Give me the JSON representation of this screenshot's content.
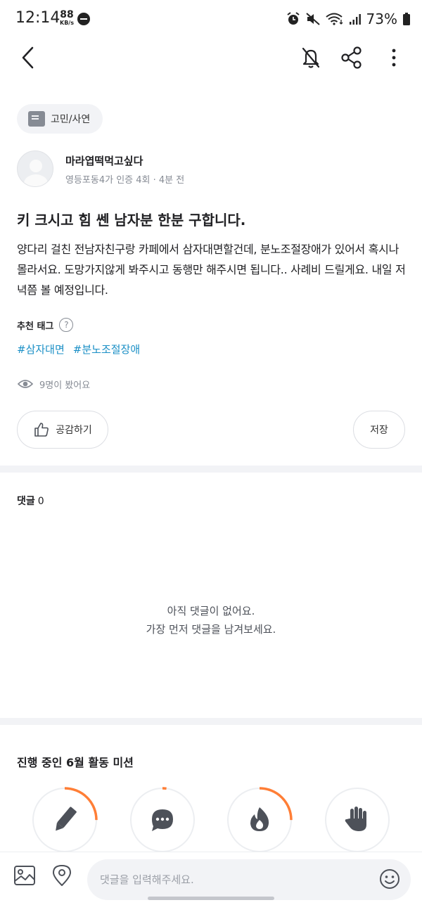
{
  "status_bar": {
    "time": "12:14",
    "net_speed_value": "88",
    "net_speed_unit": "KB/s",
    "battery": "73%",
    "icons": [
      "alarm-icon",
      "mute-icon",
      "wifi-icon",
      "signal-icon",
      "battery-icon",
      "dnd-icon"
    ]
  },
  "topbar": {
    "icons": [
      "back-icon",
      "notification-off-icon",
      "share-icon",
      "more-vertical-icon"
    ]
  },
  "post": {
    "category": "고민/사연",
    "author_name": "마라엽떡먹고싶다",
    "author_meta": "영등포동4가 인증 4회 · 4분 전",
    "title": "키 크시고 힘 쎈 남자분 한분 구합니다.",
    "body": "양다리 걸친 전남자친구랑 카페에서 삼자대면할건데, 분노조절장애가 있어서 혹시나 몰라서요. 도망가지않게 봐주시고 동행만 해주시면 됩니다.. 사례비 드릴게요. 내일 저녁쯤 볼 예정입니다.",
    "tags_heading": "추천 태그",
    "tags": [
      "#삼자대면",
      "#분노조절장애"
    ],
    "views": "9명이 봤어요",
    "like_label": "공감하기",
    "save_label": "저장"
  },
  "comments": {
    "label": "댓글",
    "count": "0",
    "empty_line1": "아직 댓글이 없어요.",
    "empty_line2": "가장 먼저 댓글을 남겨보세요."
  },
  "missions": {
    "title": "진행 중인 6월 활동 미션",
    "items": [
      {
        "icon": "pencil-icon",
        "progress": 0.25
      },
      {
        "icon": "chat-bubble-icon",
        "progress": 0.02
      },
      {
        "icon": "fire-icon",
        "progress": 0.25
      },
      {
        "icon": "wave-hand-icon",
        "progress": 0.0
      }
    ]
  },
  "input_bar": {
    "placeholder": "댓글을 입력해주세요.",
    "value": ""
  },
  "colors": {
    "accent_orange": "#ff7e36",
    "tag_blue": "#1a8fc6",
    "chip_bg": "#f2f3f6",
    "text_primary": "#212124",
    "text_secondary": "#868b94"
  }
}
